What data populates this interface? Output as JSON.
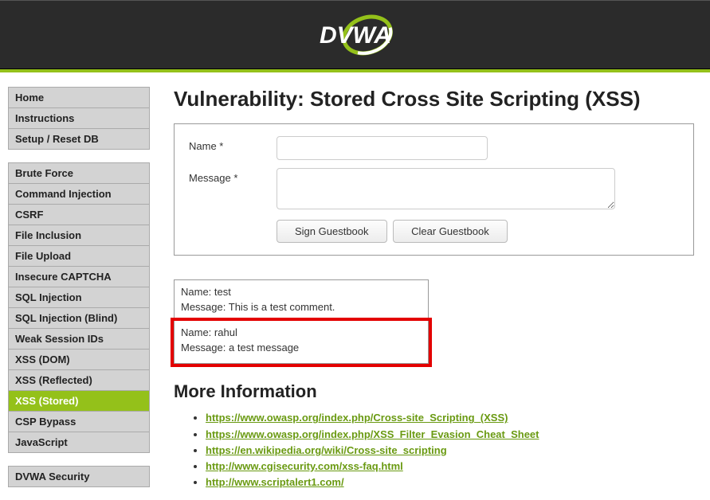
{
  "logo_text": "DVWA",
  "page_title": "Vulnerability: Stored Cross Site Scripting (XSS)",
  "nav": {
    "block1": [
      {
        "label": "Home"
      },
      {
        "label": "Instructions"
      },
      {
        "label": "Setup / Reset DB"
      }
    ],
    "block2": [
      {
        "label": "Brute Force"
      },
      {
        "label": "Command Injection"
      },
      {
        "label": "CSRF"
      },
      {
        "label": "File Inclusion"
      },
      {
        "label": "File Upload"
      },
      {
        "label": "Insecure CAPTCHA"
      },
      {
        "label": "SQL Injection"
      },
      {
        "label": "SQL Injection (Blind)"
      },
      {
        "label": "Weak Session IDs"
      },
      {
        "label": "XSS (DOM)"
      },
      {
        "label": "XSS (Reflected)"
      },
      {
        "label": "XSS (Stored)",
        "active": true
      },
      {
        "label": "CSP Bypass"
      },
      {
        "label": "JavaScript"
      }
    ],
    "block3": [
      {
        "label": "DVWA Security"
      }
    ]
  },
  "form": {
    "name_label": "Name *",
    "message_label": "Message *",
    "sign_btn": "Sign Guestbook",
    "clear_btn": "Clear Guestbook"
  },
  "entries": [
    {
      "name_label": "Name:",
      "name": "test",
      "msg_label": "Message:",
      "msg": "This is a test comment."
    },
    {
      "name_label": "Name:",
      "name": "rahul",
      "msg_label": "Message:",
      "msg": "a test message",
      "highlight": true
    }
  ],
  "more_info_heading": "More Information",
  "links": [
    "https://www.owasp.org/index.php/Cross-site_Scripting_(XSS)",
    "https://www.owasp.org/index.php/XSS_Filter_Evasion_Cheat_Sheet",
    "https://en.wikipedia.org/wiki/Cross-site_scripting",
    "http://www.cgisecurity.com/xss-faq.html",
    "http://www.scriptalert1.com/"
  ]
}
